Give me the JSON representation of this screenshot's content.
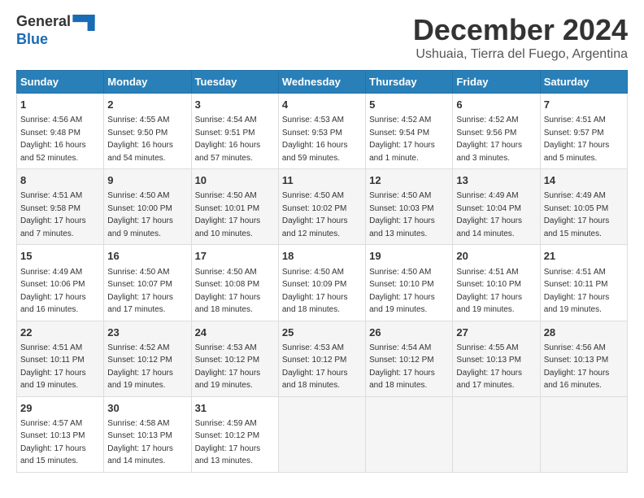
{
  "header": {
    "logo_general": "General",
    "logo_blue": "Blue",
    "month_title": "December 2024",
    "subtitle": "Ushuaia, Tierra del Fuego, Argentina"
  },
  "days_of_week": [
    "Sunday",
    "Monday",
    "Tuesday",
    "Wednesday",
    "Thursday",
    "Friday",
    "Saturday"
  ],
  "weeks": [
    [
      {
        "day": "1",
        "sunrise": "4:56 AM",
        "sunset": "9:48 PM",
        "daylight": "16 hours and 52 minutes."
      },
      {
        "day": "2",
        "sunrise": "4:55 AM",
        "sunset": "9:50 PM",
        "daylight": "16 hours and 54 minutes."
      },
      {
        "day": "3",
        "sunrise": "4:54 AM",
        "sunset": "9:51 PM",
        "daylight": "16 hours and 57 minutes."
      },
      {
        "day": "4",
        "sunrise": "4:53 AM",
        "sunset": "9:53 PM",
        "daylight": "16 hours and 59 minutes."
      },
      {
        "day": "5",
        "sunrise": "4:52 AM",
        "sunset": "9:54 PM",
        "daylight": "17 hours and 1 minute."
      },
      {
        "day": "6",
        "sunrise": "4:52 AM",
        "sunset": "9:56 PM",
        "daylight": "17 hours and 3 minutes."
      },
      {
        "day": "7",
        "sunrise": "4:51 AM",
        "sunset": "9:57 PM",
        "daylight": "17 hours and 5 minutes."
      }
    ],
    [
      {
        "day": "8",
        "sunrise": "4:51 AM",
        "sunset": "9:58 PM",
        "daylight": "17 hours and 7 minutes."
      },
      {
        "day": "9",
        "sunrise": "4:50 AM",
        "sunset": "10:00 PM",
        "daylight": "17 hours and 9 minutes."
      },
      {
        "day": "10",
        "sunrise": "4:50 AM",
        "sunset": "10:01 PM",
        "daylight": "17 hours and 10 minutes."
      },
      {
        "day": "11",
        "sunrise": "4:50 AM",
        "sunset": "10:02 PM",
        "daylight": "17 hours and 12 minutes."
      },
      {
        "day": "12",
        "sunrise": "4:50 AM",
        "sunset": "10:03 PM",
        "daylight": "17 hours and 13 minutes."
      },
      {
        "day": "13",
        "sunrise": "4:49 AM",
        "sunset": "10:04 PM",
        "daylight": "17 hours and 14 minutes."
      },
      {
        "day": "14",
        "sunrise": "4:49 AM",
        "sunset": "10:05 PM",
        "daylight": "17 hours and 15 minutes."
      }
    ],
    [
      {
        "day": "15",
        "sunrise": "4:49 AM",
        "sunset": "10:06 PM",
        "daylight": "17 hours and 16 minutes."
      },
      {
        "day": "16",
        "sunrise": "4:50 AM",
        "sunset": "10:07 PM",
        "daylight": "17 hours and 17 minutes."
      },
      {
        "day": "17",
        "sunrise": "4:50 AM",
        "sunset": "10:08 PM",
        "daylight": "17 hours and 18 minutes."
      },
      {
        "day": "18",
        "sunrise": "4:50 AM",
        "sunset": "10:09 PM",
        "daylight": "17 hours and 18 minutes."
      },
      {
        "day": "19",
        "sunrise": "4:50 AM",
        "sunset": "10:10 PM",
        "daylight": "17 hours and 19 minutes."
      },
      {
        "day": "20",
        "sunrise": "4:51 AM",
        "sunset": "10:10 PM",
        "daylight": "17 hours and 19 minutes."
      },
      {
        "day": "21",
        "sunrise": "4:51 AM",
        "sunset": "10:11 PM",
        "daylight": "17 hours and 19 minutes."
      }
    ],
    [
      {
        "day": "22",
        "sunrise": "4:51 AM",
        "sunset": "10:11 PM",
        "daylight": "17 hours and 19 minutes."
      },
      {
        "day": "23",
        "sunrise": "4:52 AM",
        "sunset": "10:12 PM",
        "daylight": "17 hours and 19 minutes."
      },
      {
        "day": "24",
        "sunrise": "4:53 AM",
        "sunset": "10:12 PM",
        "daylight": "17 hours and 19 minutes."
      },
      {
        "day": "25",
        "sunrise": "4:53 AM",
        "sunset": "10:12 PM",
        "daylight": "17 hours and 18 minutes."
      },
      {
        "day": "26",
        "sunrise": "4:54 AM",
        "sunset": "10:12 PM",
        "daylight": "17 hours and 18 minutes."
      },
      {
        "day": "27",
        "sunrise": "4:55 AM",
        "sunset": "10:13 PM",
        "daylight": "17 hours and 17 minutes."
      },
      {
        "day": "28",
        "sunrise": "4:56 AM",
        "sunset": "10:13 PM",
        "daylight": "17 hours and 16 minutes."
      }
    ],
    [
      {
        "day": "29",
        "sunrise": "4:57 AM",
        "sunset": "10:13 PM",
        "daylight": "17 hours and 15 minutes."
      },
      {
        "day": "30",
        "sunrise": "4:58 AM",
        "sunset": "10:13 PM",
        "daylight": "17 hours and 14 minutes."
      },
      {
        "day": "31",
        "sunrise": "4:59 AM",
        "sunset": "10:12 PM",
        "daylight": "17 hours and 13 minutes."
      },
      null,
      null,
      null,
      null
    ]
  ]
}
